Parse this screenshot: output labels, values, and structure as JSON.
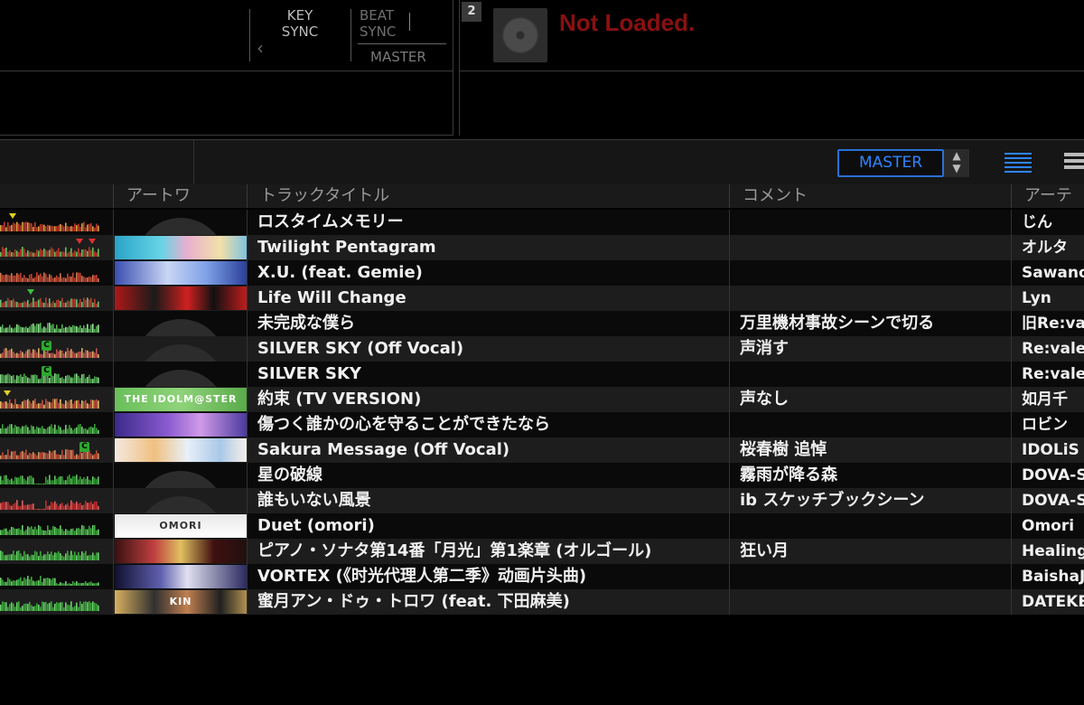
{
  "deck1": {
    "key_sync_line1": "KEY",
    "key_sync_line2": "SYNC",
    "key_arrow": "‹",
    "beat_sync_line1": "BEAT",
    "beat_sync_line2": "SYNC",
    "master_label": "MASTER"
  },
  "deck2": {
    "number": "2",
    "status": "Not Loaded."
  },
  "toolbar": {
    "master_select": "MASTER",
    "select_arrows": "⌃⌄",
    "list_view_icon": "list-view-icon",
    "grid_view_icon": "grid-view-icon"
  },
  "columns": {
    "artwork": "アートワ",
    "title": "トラックタイトル",
    "comment": "コメント",
    "artist": "アーテ"
  },
  "colors": {
    "accent_blue": "#2f84ff",
    "not_loaded_red": "#8a1010",
    "cue_green": "#2fa82f"
  },
  "tracks": [
    {
      "title": "ロスタイムメモリー",
      "comment": "",
      "artist": "じん",
      "art": "none"
    },
    {
      "title": "Twilight Pentagram",
      "comment": "",
      "artist": "オルタ",
      "art": "a1"
    },
    {
      "title": "X.U. (feat. Gemie)",
      "comment": "",
      "artist": "Sawano",
      "art": "a2"
    },
    {
      "title": "Life Will Change",
      "comment": "",
      "artist": "Lyn",
      "art": "a3"
    },
    {
      "title": "未完成な僕ら",
      "comment": "万里機材事故シーンで切る",
      "artist": "旧Re:va",
      "art": "none"
    },
    {
      "title": "SILVER SKY (Off Vocal)",
      "comment": "声消す",
      "artist": "Re:vale",
      "art": "none"
    },
    {
      "title": "SILVER SKY",
      "comment": "",
      "artist": "Re:vale",
      "art": "none"
    },
    {
      "title": "約束 (TV VERSION)",
      "comment": "声なし",
      "artist": "如月千",
      "art": "a4",
      "art_text": "THE IDOLM@STER"
    },
    {
      "title": "傷つく誰かの心を守ることができたなら",
      "comment": "",
      "artist": "ロビン",
      "art": "a5"
    },
    {
      "title": "Sakura Message (Off Vocal)",
      "comment": "桜春樹 追悼",
      "artist": "IDOLiS",
      "art": "a6"
    },
    {
      "title": "星の破線",
      "comment": "霧雨が降る森",
      "artist": "DOVA-S",
      "art": "none"
    },
    {
      "title": "誰もいない風景",
      "comment": "ib スケッチブックシーン",
      "artist": "DOVA-S",
      "art": "none"
    },
    {
      "title": "Duet (omori)",
      "comment": "",
      "artist": "Omori",
      "art": "a7",
      "art_text": "OMORI"
    },
    {
      "title": "ピアノ・ソナタ第14番「月光」第1楽章 (オルゴール)",
      "comment": "狂い月",
      "artist": "Healing",
      "art": "a8"
    },
    {
      "title": "VORTEX (《时光代理人第二季》动画片头曲)",
      "comment": "",
      "artist": "BaishaJ",
      "art": "a9"
    },
    {
      "title": "蜜月アン・ドゥ・トロワ (feat. 下田麻美)",
      "comment": "",
      "artist": "DATEKE",
      "art": "a10",
      "art_text": "KIN"
    }
  ]
}
